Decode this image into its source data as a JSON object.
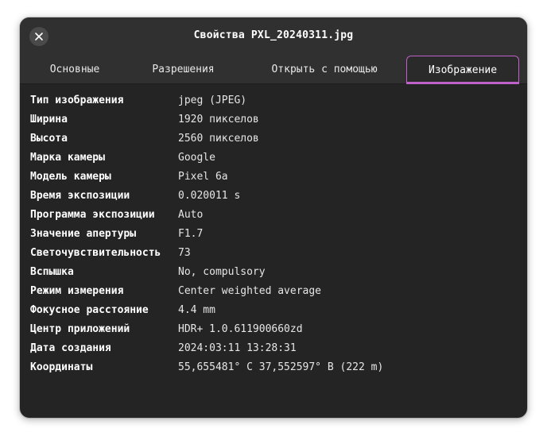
{
  "window": {
    "title": "Свойства PXL_20240311.jpg",
    "close_icon": "close-icon"
  },
  "tabs": [
    {
      "label": "Основные",
      "active": false
    },
    {
      "label": "Разрешения",
      "active": false
    },
    {
      "label": "Открыть с помощью",
      "active": false
    },
    {
      "label": "Изображение",
      "active": true
    }
  ],
  "colors": {
    "accent": "#c061cb",
    "window_bg": "#242424",
    "header_bg": "#303030"
  },
  "properties": [
    {
      "label": "Тип изображения",
      "value": "jpeg (JPEG)"
    },
    {
      "label": "Ширина",
      "value": "1920 пикселов"
    },
    {
      "label": "Высота",
      "value": "2560 пикселов"
    },
    {
      "label": "Марка камеры",
      "value": "Google"
    },
    {
      "label": "Модель камеры",
      "value": "Pixel 6a"
    },
    {
      "label": "Время экспозиции",
      "value": "0.020011 s"
    },
    {
      "label": "Программа экспозиции",
      "value": "Auto"
    },
    {
      "label": "Значение апертуры",
      "value": "F1.7"
    },
    {
      "label": "Светочувствительность",
      "value": "73"
    },
    {
      "label": "Вспышка",
      "value": "No, compulsory"
    },
    {
      "label": "Режим измерения",
      "value": "Center weighted average"
    },
    {
      "label": "Фокусное расстояние",
      "value": "4.4 mm"
    },
    {
      "label": "Центр приложений",
      "value": "HDR+ 1.0.611900660zd"
    },
    {
      "label": "Дата создания",
      "value": "2024:03:11 13:28:31"
    },
    {
      "label": "Координаты",
      "value": "55,655481° С 37,552597° В (222 m)"
    }
  ]
}
